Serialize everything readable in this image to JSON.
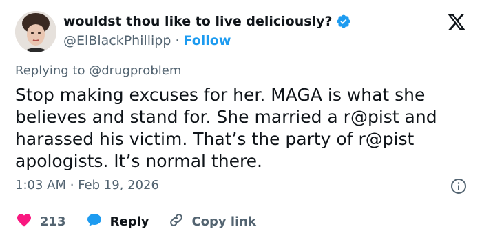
{
  "header": {
    "display_name": "wouldst thou like to live deliciously?",
    "handle": "@ElBlackPhillipp",
    "separator": "·",
    "follow_label": "Follow"
  },
  "replying_to": {
    "prefix": "Replying to",
    "mention": "@drugproblem"
  },
  "tweet": {
    "text": "Stop making excuses for her. MAGA is what she\nbelieves and stand for. She married a r@pist and\nharassed his victim. That’s the party of r@pist\napologists. It’s normal there.",
    "time": "1:03 AM",
    "separator": "·",
    "date": "Feb 19, 2026"
  },
  "actions": {
    "likes": "213",
    "reply_label": "Reply",
    "copy_link_label": "Copy link"
  },
  "colors": {
    "accent": "#1d9bf0",
    "like": "#f91880",
    "muted": "#536471"
  },
  "icons": {
    "verified": "verified-badge-icon",
    "logo": "x-logo-icon",
    "info": "info-icon",
    "like": "heart-icon",
    "reply": "reply-bubble-icon",
    "link": "link-icon"
  }
}
